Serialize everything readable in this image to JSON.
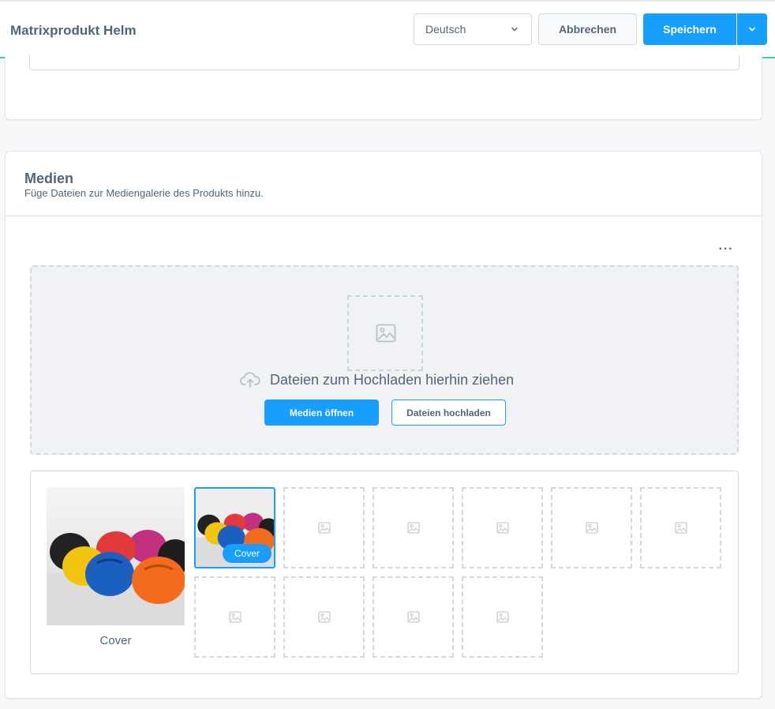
{
  "header": {
    "title": "Matrixprodukt Helm",
    "language_select": {
      "value": "Deutsch"
    },
    "cancel_label": "Abbrechen",
    "save_label": "Speichern"
  },
  "media": {
    "title": "Medien",
    "subtitle": "Füge Dateien zur Mediengalerie des Produkts hinzu.",
    "more_label": "···",
    "dropzone": {
      "text": "Dateien zum Hochladen hierhin ziehen",
      "open_media_label": "Medien öffnen",
      "upload_files_label": "Dateien hochladen"
    },
    "gallery": {
      "cover_label": "Cover",
      "selected_badge": "Cover",
      "empty_slots": 9
    }
  },
  "colors": {
    "primary": "#189eff",
    "accent_line": "#37d39a",
    "text": "#52667a",
    "border": "#d1d9e0"
  }
}
